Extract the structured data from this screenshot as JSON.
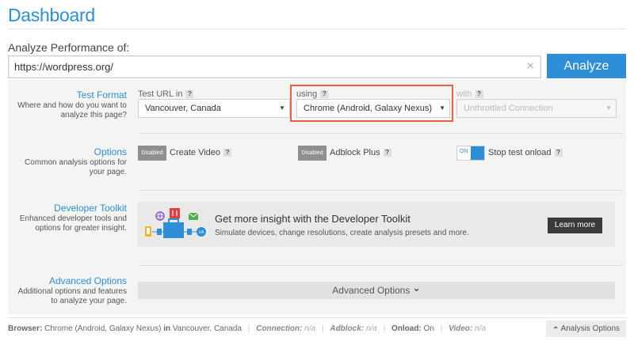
{
  "header": {
    "title": "Dashboard"
  },
  "analyze": {
    "label": "Analyze Performance of:",
    "url_value": "https://wordpress.org/",
    "clear_icon": "×",
    "button_label": "Analyze"
  },
  "test_format": {
    "title": "Test Format",
    "desc_line1": "Where and how do you want to",
    "desc_line2": "analyze this page?",
    "location_label": "Test URL in",
    "location_value": "Vancouver, Canada",
    "browser_label": "using",
    "browser_value": "Chrome (Android, Galaxy Nexus)",
    "connection_label": "with",
    "connection_value": "Unthrottled Connection",
    "help_glyph": "?"
  },
  "options": {
    "title": "Options",
    "desc_line1": "Common analysis options for",
    "desc_line2": "your page.",
    "create_video": {
      "state": "Disabled",
      "label": "Create Video"
    },
    "adblock": {
      "state": "Disabled",
      "label": "Adblock Plus"
    },
    "stop_onload": {
      "state": "ON",
      "label": "Stop test onload"
    }
  },
  "developer_toolkit": {
    "title": "Developer Toolkit",
    "desc_line1": "Enhanced developer tools and",
    "desc_line2": "options for greater insight.",
    "promo_title": "Get more insight with the Developer Toolkit",
    "promo_desc": "Simulate devices, change resolutions, create analysis presets and more.",
    "learn_more": "Learn more"
  },
  "advanced": {
    "title": "Advanced Options",
    "desc_line1": "Additional options and features",
    "desc_line2": "to analyze your page.",
    "bar_label": "Advanced Options",
    "bar_chevron": "⌄"
  },
  "footer": {
    "browser_key": "Browser:",
    "browser_val": "Chrome (Android, Galaxy Nexus)",
    "in_word": "in",
    "location_val": "Vancouver, Canada",
    "connection_key": "Connection:",
    "connection_val": "n/a",
    "adblock_key": "Adblock:",
    "adblock_val": "n/a",
    "onload_key": "Onload:",
    "onload_val": "On",
    "video_key": "Video:",
    "video_val": "n/a",
    "analysis_options": "Analysis Options",
    "analysis_chevron": "⌃"
  },
  "colors": {
    "accent": "#2e8ed8",
    "highlight": "#e8603c",
    "panel": "#f4f4f4"
  }
}
